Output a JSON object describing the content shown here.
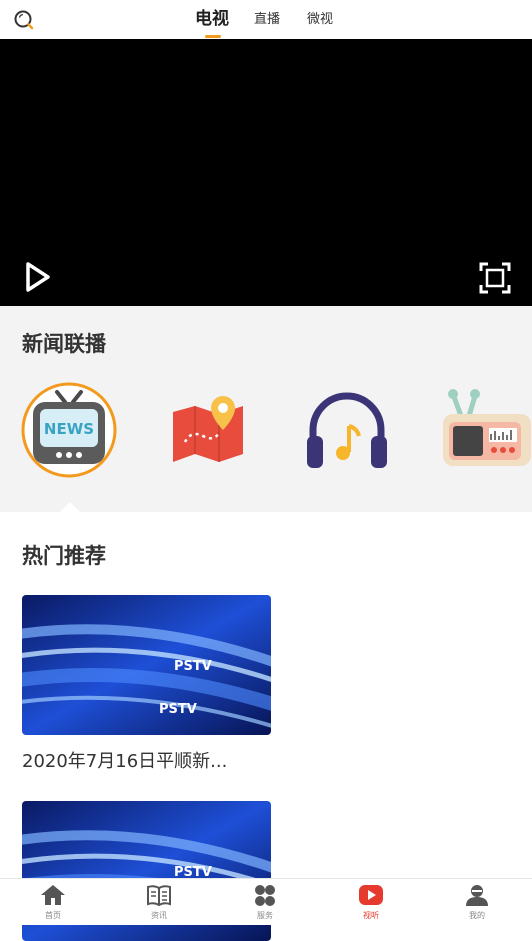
{
  "header": {
    "tabs": [
      {
        "label": "电视",
        "active": true
      },
      {
        "label": "直播",
        "active": false
      },
      {
        "label": "微视",
        "active": false
      }
    ],
    "accent_color": "#f39a1e"
  },
  "player": {
    "play_icon": "play-icon",
    "fullscreen_icon": "fullscreen-icon"
  },
  "channels": {
    "title": "新闻联播",
    "items": [
      {
        "icon": "news-tv-icon",
        "selected": true
      },
      {
        "icon": "map-pin-icon",
        "selected": false
      },
      {
        "icon": "headphones-music-icon",
        "selected": false
      },
      {
        "icon": "radio-icon",
        "selected": false
      }
    ]
  },
  "recommend": {
    "title": "热门推荐",
    "items": [
      {
        "title": "2020年7月16日平顺新...",
        "logo": "PSTV"
      },
      {
        "title": "",
        "logo": "PSTV"
      }
    ]
  },
  "bottom_nav": {
    "items": [
      {
        "label": "首页",
        "icon": "home-icon"
      },
      {
        "label": "资讯",
        "icon": "book-icon"
      },
      {
        "label": "服务",
        "icon": "grid-icon"
      },
      {
        "label": "视听",
        "icon": "video-play-icon",
        "active": true
      },
      {
        "label": "我的",
        "icon": "user-icon"
      }
    ],
    "active_color": "#e53a2d"
  }
}
